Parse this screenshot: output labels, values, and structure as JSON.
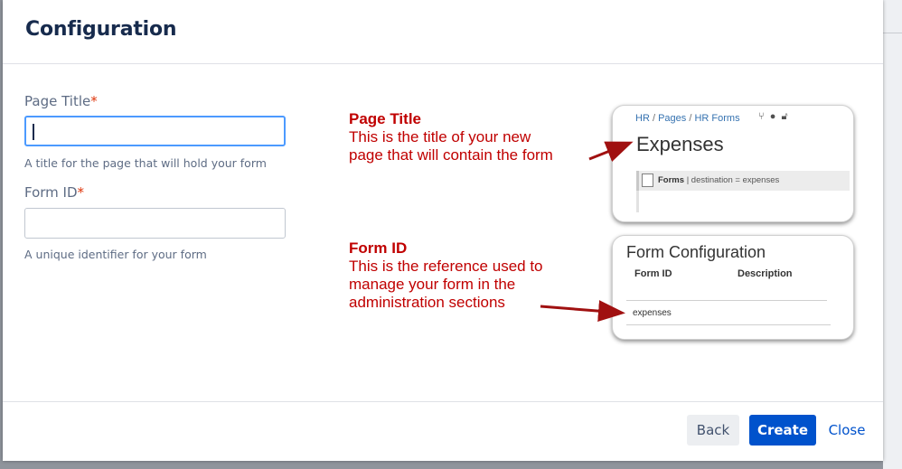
{
  "dialog": {
    "title": "Configuration",
    "page_title_field": {
      "label": "Page Title",
      "required_mark": "*",
      "value": "",
      "help": "A title for the page that will hold your form"
    },
    "form_id_field": {
      "label": "Form ID",
      "required_mark": "*",
      "value": "",
      "help": "A unique identifier for your form"
    },
    "footer": {
      "back_label": "Back",
      "create_label": "Create",
      "close_label": "Close"
    }
  },
  "illustration": {
    "annotation_page_title": {
      "title": "Page Title",
      "lines": [
        "This is the title of your new",
        "page that will contain the form"
      ]
    },
    "annotation_form_id": {
      "title": "Form ID",
      "lines": [
        "This is the reference used to",
        "manage your form in the",
        "administration sections"
      ]
    },
    "page_preview": {
      "breadcrumb": [
        "HR",
        "Pages",
        "HR Forms"
      ],
      "breadcrumb_sep": "/",
      "heading": "Expenses",
      "macro_name": "Forms",
      "macro_params": "| destination = expenses"
    },
    "form_config_preview": {
      "title": "Form Configuration",
      "columns": [
        "Form ID",
        "Description"
      ],
      "row": "expenses"
    }
  },
  "colors": {
    "accent": "#0052cc",
    "focus_border": "#4c9aff",
    "required": "#de350b",
    "annotation": "#c00000"
  }
}
